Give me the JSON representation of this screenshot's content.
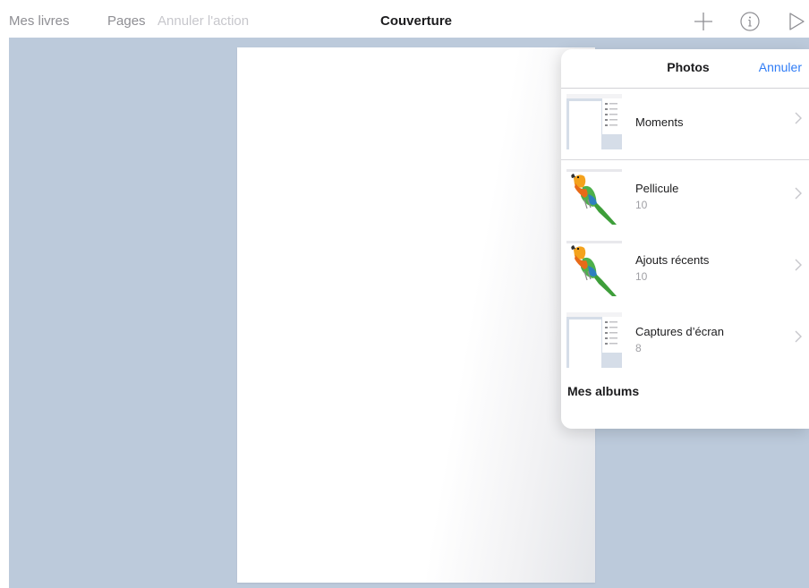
{
  "navbar": {
    "my_books": "Mes livres",
    "pages": "Pages",
    "undo": "Annuler l'action",
    "title": "Couverture",
    "icons": [
      "plus-icon",
      "info-icon",
      "play-icon"
    ]
  },
  "popover": {
    "title": "Photos",
    "cancel": "Annuler",
    "albums": [
      {
        "name": "Moments",
        "count": "",
        "thumb": "screenshot"
      },
      {
        "name": "Pellicule",
        "count": "10",
        "thumb": "parrot"
      },
      {
        "name": "Ajouts récents",
        "count": "10",
        "thumb": "parrot"
      },
      {
        "name": "Captures d’écran",
        "count": "8",
        "thumb": "screenshot"
      }
    ],
    "section_title": "Mes albums"
  },
  "colors": {
    "workspace": "#bccadb",
    "accent": "#2f7cf6",
    "nav_text": "#8e8e93"
  }
}
